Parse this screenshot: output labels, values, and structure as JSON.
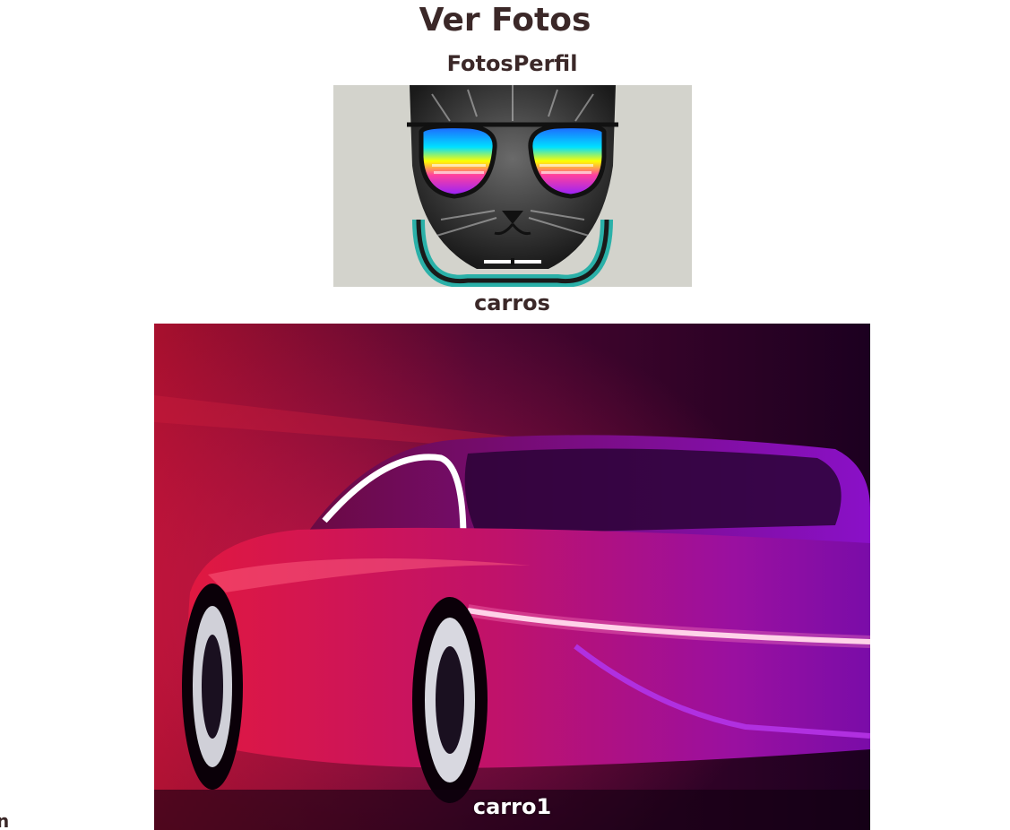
{
  "page": {
    "title": "Ver Fotos"
  },
  "albums": [
    {
      "name": "FotosPerfil",
      "photo": {
        "subject": "cat-with-sunglasses-and-headphones",
        "caption": ""
      }
    },
    {
      "name": "carros",
      "photo": {
        "subject": "red-purple-sports-car",
        "caption": "carro1"
      }
    }
  ],
  "edge_text": "n",
  "colors": {
    "text": "#3b2828",
    "cat_background": "#d3d3cc",
    "car_red": "#d0174a",
    "car_magenta": "#b0108a",
    "car_purple": "#7a0ca8"
  }
}
